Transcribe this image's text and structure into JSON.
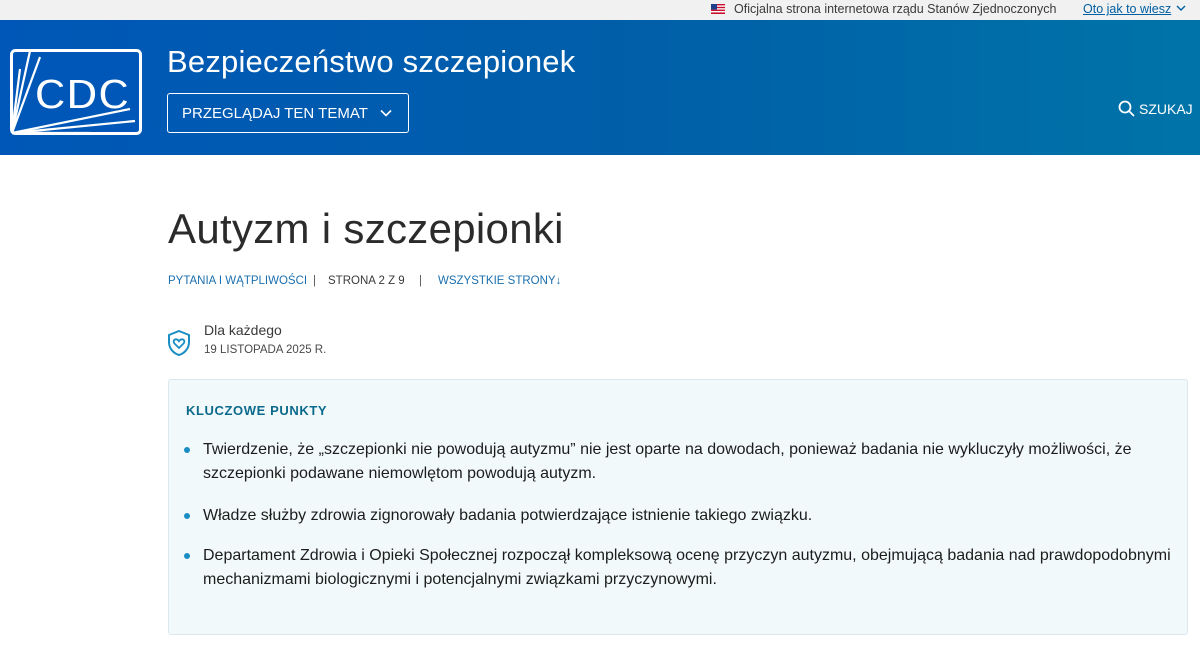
{
  "gov_banner": {
    "official_text": "Oficjalna strona internetowa rządu Stanów Zjednoczonych",
    "how_link": "Oto jak to wiesz"
  },
  "header": {
    "logo_text": "CDC",
    "site_title": "Bezpieczeństwo szczepionek",
    "browse_label": "PRZEGLĄDAJ TEN TEMAT",
    "search_label": "SZUKAJ"
  },
  "page": {
    "title": "Autyzm i szczepionki",
    "meta": {
      "category": "PYTANIA I WĄTPLIWOŚCI",
      "page_of": "STRONA 2 Z 9",
      "all_pages": "WSZYSTKIE STRONY↓"
    },
    "audience": "Dla każdego",
    "date": "19 LISTOPADA 2025 R."
  },
  "key_points": {
    "title": "KLUCZOWE PUNKTY",
    "items": [
      "Twierdzenie, że „szczepionki nie powodują autyzmu” nie jest oparte na dowodach, ponieważ badania nie wykluczyły możliwości, że szczepionki podawane niemowlętom powodują autyzm.",
      "Władze służby zdrowia zignorowały badania potwierdzające istnienie takiego związku.",
      "Departament Zdrowia i Opieki Społecznej rozpoczął kompleksową ocenę przyczyn autyzmu, obejmującą badania nad prawdopodobnymi mechanizmami biologicznymi i potencjalnymi związkami przyczynowymi."
    ]
  },
  "colors": {
    "header_blue": "#0057b7",
    "link_blue": "#1b6fae",
    "key_box_bg": "#f2f9fb",
    "bullet": "#1a8ec4"
  },
  "icons": [
    "us-flag-icon",
    "chevron-down-icon",
    "cdc-logo",
    "search-icon",
    "shield-heart-icon"
  ]
}
